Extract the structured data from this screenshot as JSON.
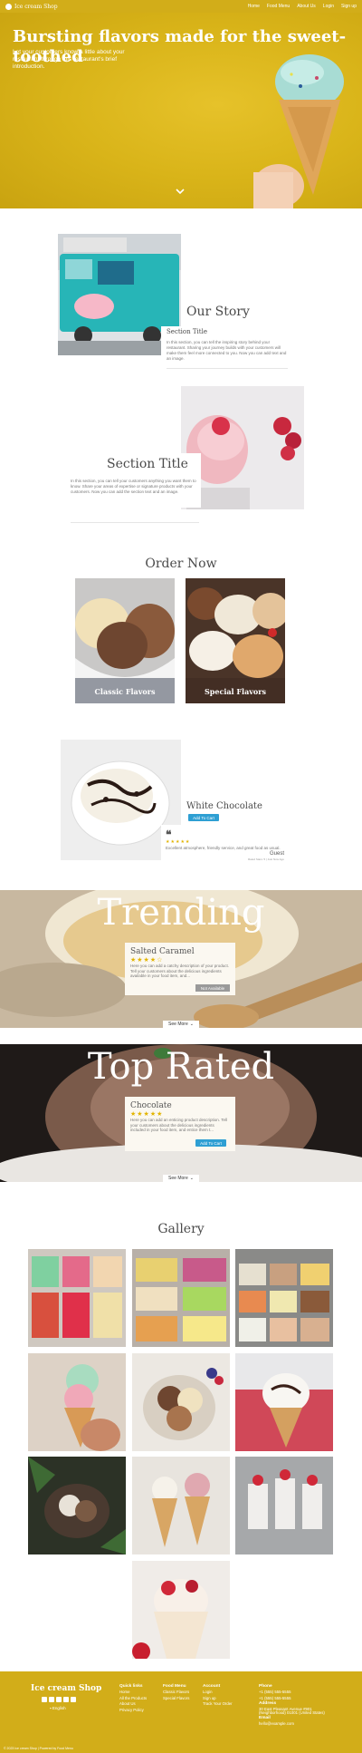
{
  "nav": {
    "brand": "Ice cream Shop",
    "links": [
      "Home",
      "Food Menu",
      "About Us",
      "Login",
      "Sign up"
    ]
  },
  "hero": {
    "title": "Bursting flavors made for the sweet-toothed",
    "subtitle": "Let your customers know a little about your restaurant through this restaurant's brief introduction."
  },
  "story": {
    "heading": "Our Story",
    "section_title": "Section Title",
    "section_text": "In this section, you can tell the inspiring story behind your restaurant. Sharing your journey builds with your customers will make them feel more connected to you. Now you can add text and an image."
  },
  "section2": {
    "heading": "Section Title",
    "text": "In this section, you can tell your customers anything you want them to know. Share your areas of expertise or signature products with your customers. Now you can add the section text and an image."
  },
  "order": {
    "heading": "Order Now",
    "items": [
      {
        "label": "Classic Flavors"
      },
      {
        "label": "Special Flavors"
      }
    ]
  },
  "featured": {
    "name": "White Chocolate",
    "button": "Add To Cart",
    "quote_icon": "quote-icon",
    "stars": "★★★★★",
    "review": "Excellent atmosphere, friendly service, and great food as usual.",
    "reviewer": "Guest",
    "review_meta": "Rated Stars: 5 | Just Now Ago"
  },
  "trending": {
    "title": "Trending",
    "product": "Salted Caramel",
    "stars": "★★★★☆",
    "description": "Here you can add a catchy description of your product. Tell your customers about the delicious ingredients available in your food item, and...",
    "button": "Not Available",
    "see_more": "See More"
  },
  "top_rated": {
    "title": "Top Rated",
    "product": "Chocolate",
    "stars": "★★★★★",
    "description": "Here you can add an enticing product description. Tell your customers about the delicious ingredients included in your food item, and entice them t...",
    "button": "Add To Cart",
    "see_more": "See More"
  },
  "gallery": {
    "heading": "Gallery"
  },
  "footer": {
    "brand": "Ice cream Shop",
    "language": "English",
    "quick_links": {
      "heading": "Quick links",
      "items": [
        "Home",
        "All the Products",
        "About Us",
        "Privacy Policy"
      ]
    },
    "food_menu": {
      "heading": "Food Menu",
      "items": [
        "Classic Flavors",
        "Special Flavors"
      ]
    },
    "account": {
      "heading": "Account",
      "items": [
        "Login",
        "Sign up",
        "Track Your Order"
      ]
    },
    "contact": {
      "phone_heading": "Phone",
      "phones": [
        "+1 (555) 555-5555",
        "+1 (555) 555-5555"
      ],
      "address_heading": "Address",
      "address": [
        "30 East Pleasant Avenue #901 (Neighborhood) 01001 (United States)"
      ],
      "email_heading": "Email",
      "email": "hello@example.com"
    },
    "copyright": "© 2023 Ice cream Shop | Powered by Food Menu"
  },
  "colors": {
    "brand_yellow": "#d2ad19",
    "accent_blue": "#2e9fd3",
    "star_gold": "#e2b400"
  }
}
